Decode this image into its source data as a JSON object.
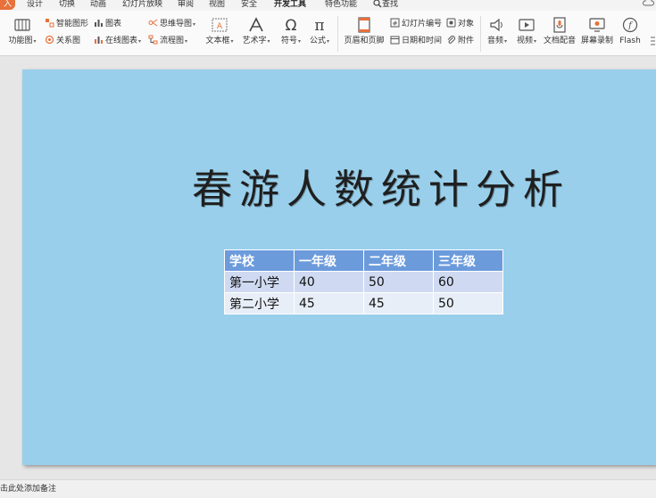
{
  "menu": {
    "active_tab": "入",
    "tabs": [
      "设计",
      "切换",
      "动画",
      "幻灯片放映",
      "审阅",
      "视图",
      "安全",
      "开发工具",
      "特色功能"
    ],
    "search_label": "查找"
  },
  "ribbon": {
    "function_chart": "功能图",
    "smart_graphic": "智能图形",
    "relationship_chart": "关系图",
    "chart": "图表",
    "online_chart": "在线图表",
    "mind_map": "思维导图",
    "flowchart": "流程图",
    "text_box": "文本框",
    "art_text": "艺术字",
    "symbol": "符号",
    "formula": "公式",
    "header_footer": "页眉和页脚",
    "slide_number": "幻灯片编号",
    "object": "对象",
    "date_time": "日期和时间",
    "attachment": "附件",
    "audio": "音频",
    "video": "视频",
    "doc_dubbing": "文档配音",
    "screen_record": "屏幕录制",
    "flash": "Flash"
  },
  "slide": {
    "title": "春游人数统计分析",
    "table": {
      "headers": [
        "学校",
        "一年级",
        "二年级",
        "三年级"
      ],
      "rows": [
        [
          "第一小学",
          "40",
          "50",
          "60"
        ],
        [
          "第二小学",
          "45",
          "45",
          "50"
        ]
      ]
    }
  },
  "status": {
    "notes_placeholder": "击此处添加备注"
  },
  "colors": {
    "slide_bg": "#99cfeb",
    "header_bg": "#6c9bdc",
    "active_tab": "#e8703a"
  }
}
